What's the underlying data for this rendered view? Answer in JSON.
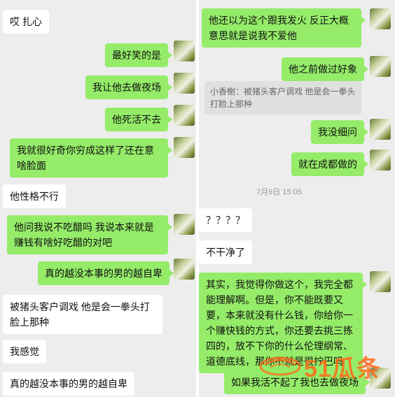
{
  "left_messages": [
    {
      "text": "哎 扎心"
    },
    {
      "text": "最好笑的是"
    },
    {
      "text": "我让他去做夜场"
    },
    {
      "text": "他死活不去"
    },
    {
      "text": "我就很好奇你穷成这样了还在意啥脸面"
    },
    {
      "text": "他性格不行"
    },
    {
      "text": "他问我说不吃醋吗 我说本来就是赚钱有啥好吃醋的对吧"
    },
    {
      "text": "真的越没本事的男的越自卑"
    },
    {
      "text": "被猪头客户调戏 他是会一拳头打脸上那种"
    },
    {
      "text": "我感觉"
    },
    {
      "text": "真的越没本事的男的越自卑"
    }
  ],
  "right_messages": [
    {
      "text": "他还以为这个跟我发火 反正大概意思就是说我不爱他"
    },
    {
      "text": "他之前做过好象"
    },
    {
      "text": "小香榭：被猪头客户调戏 他是会一拳头打脸上那种"
    },
    {
      "text": "我没细问"
    },
    {
      "text": "就在成都做的"
    },
    {
      "text": "7月9日 15:05"
    },
    {
      "text": "？？？？"
    },
    {
      "text": "不干净了"
    },
    {
      "text": "其实，我觉得你做这个，我完全都能理解啊。但是，你不能既要又要，本来就没有什么钱，你给你一个赚快钱的方式，你还要去挑三拣四的，放不下你的什么伦理纲常、道德底线，那你不就是很拧巴吗"
    },
    {
      "text": "如果我活不起了我也去做夜场"
    }
  ],
  "watermark": {
    "text": "51瓜条",
    "color": "#ff6a1a"
  },
  "colors": {
    "background": "#ededed",
    "self_bubble": "#95ec69",
    "other_bubble": "#ffffff"
  }
}
